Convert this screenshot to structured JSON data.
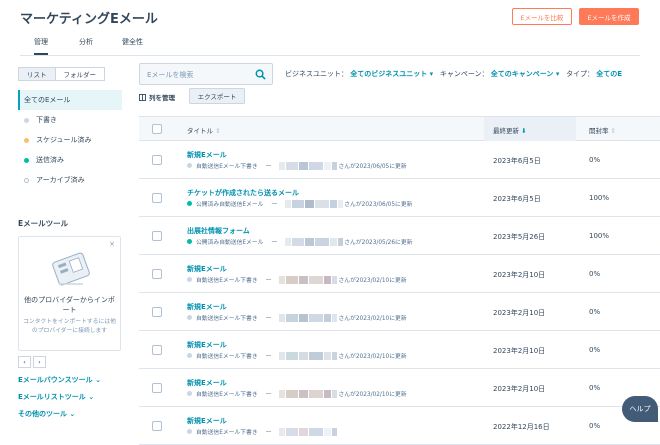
{
  "header": {
    "title": "マーケティングEメール",
    "compare_label": "Eメールを比較",
    "create_label": "Eメールを作成"
  },
  "tabs": [
    {
      "label": "管理",
      "active": true
    },
    {
      "label": "分析",
      "active": false
    },
    {
      "label": "健全性",
      "active": false
    }
  ],
  "view_toggle": {
    "list": "リスト",
    "folder": "フォルダー"
  },
  "sidebar": {
    "items": [
      {
        "label": "全てのEメール",
        "active": true,
        "dot": ""
      },
      {
        "label": "下書き",
        "dot": "#cbd6e2"
      },
      {
        "label": "スケジュール済み",
        "dot": "#f5c26b"
      },
      {
        "label": "送信済み",
        "dot": "#00bda5"
      },
      {
        "label": "アーカイブ済み",
        "dot": "outline"
      }
    ],
    "tools_heading": "Eメールツール",
    "import_card": {
      "title": "他のプロバイダーからインポート",
      "desc": "コンタクトをインポートするには他のプロバイダーに接続します"
    },
    "tool_links": [
      "Eメールバウンスツール ⌄",
      "Eメールリストツール ⌄",
      "その他のツール ⌄"
    ]
  },
  "toolbar": {
    "search_placeholder": "Eメールを検索",
    "business_unit_label": "ビジネスユニット：",
    "business_unit_value": "全てのビジネスユニット ▾",
    "campaign_label": "キャンペーン：",
    "campaign_value": "全てのキャンペーン ▾",
    "type_label": "タイプ：",
    "type_value": "全てのE",
    "manage_columns": "列を管理",
    "export": "エクスポート"
  },
  "table": {
    "headers": {
      "title": "タイトル",
      "last_updated": "最終更新",
      "open_rate": "開封率"
    },
    "rows": [
      {
        "name": "新規Eメール",
        "status": "自動送信Eメール下書き",
        "status_dot": "#cbd6e2",
        "updated": "さんが2023/06/05に更新",
        "date": "2023年6月5日",
        "rate": "0%"
      },
      {
        "name": "チケットが作成されたら送るメール",
        "status": "公開済み自動送信Eメール",
        "status_dot": "#00bda5",
        "updated": "さんが2023/06/05に更新",
        "date": "2023年6月5日",
        "rate": "100%"
      },
      {
        "name": "出展社情報フォーム",
        "status": "公開済み自動送信Eメール",
        "status_dot": "#00bda5",
        "updated": "さんが2023/05/26に更新",
        "date": "2023年5月26日",
        "rate": "100%"
      },
      {
        "name": "新規Eメール",
        "status": "自動送信Eメール下書き",
        "status_dot": "#cbd6e2",
        "updated": "さんが2023/02/10に更新",
        "date": "2023年2月10日",
        "rate": "0%"
      },
      {
        "name": "新規Eメール",
        "status": "自動送信Eメール下書き",
        "status_dot": "#cbd6e2",
        "updated": "さんが2023/02/10に更新",
        "date": "2023年2月10日",
        "rate": "0%"
      },
      {
        "name": "新規Eメール",
        "status": "自動送信Eメール下書き",
        "status_dot": "#cbd6e2",
        "updated": "さんが2023/02/10に更新",
        "date": "2023年2月10日",
        "rate": "0%"
      },
      {
        "name": "新規Eメール",
        "status": "自動送信Eメール下書き",
        "status_dot": "#cbd6e2",
        "updated": "さんが2023/02/10に更新",
        "date": "2023年2月10日",
        "rate": "0%"
      },
      {
        "name": "新規Eメール",
        "status": "自動送信Eメール下書き",
        "status_dot": "#cbd6e2",
        "updated": "",
        "date": "2022年12月16日",
        "rate": "0%"
      }
    ]
  },
  "help_label": "ヘルプ"
}
